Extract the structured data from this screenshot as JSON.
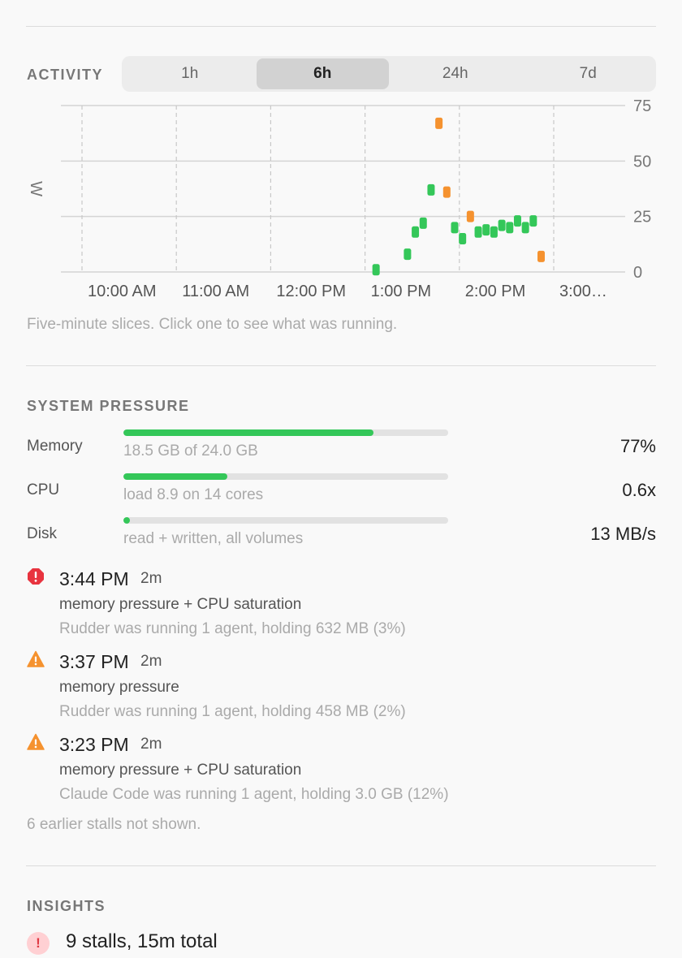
{
  "activity": {
    "title": "ACTIVITY",
    "ranges": [
      "1h",
      "6h",
      "24h",
      "7d"
    ],
    "selected_range": "6h",
    "hint": "Five-minute slices. Click one to see what was running."
  },
  "chart_data": {
    "type": "scatter",
    "ylabel": "W",
    "ylim": [
      0,
      75
    ],
    "yticks": [
      0,
      25,
      50,
      75
    ],
    "x_labels": [
      "10:00 AM",
      "11:00 AM",
      "12:00 PM",
      "1:00 PM",
      "2:00 PM",
      "3:00…"
    ],
    "x_unit": "hours since 10:00 AM on tick axis",
    "grid": true,
    "colors": {
      "normal": "#34c759",
      "stall": "#f5922f"
    },
    "points": [
      {
        "x": "13:07",
        "y": 1,
        "status": "normal"
      },
      {
        "x": "13:27",
        "y": 8,
        "status": "normal"
      },
      {
        "x": "13:32",
        "y": 18,
        "status": "normal"
      },
      {
        "x": "13:37",
        "y": 22,
        "status": "normal"
      },
      {
        "x": "13:42",
        "y": 37,
        "status": "normal"
      },
      {
        "x": "13:47",
        "y": 67,
        "status": "stall"
      },
      {
        "x": "13:52",
        "y": 36,
        "status": "stall"
      },
      {
        "x": "13:57",
        "y": 20,
        "status": "normal"
      },
      {
        "x": "14:02",
        "y": 15,
        "status": "normal"
      },
      {
        "x": "14:07",
        "y": 25,
        "status": "stall"
      },
      {
        "x": "14:12",
        "y": 18,
        "status": "normal"
      },
      {
        "x": "14:17",
        "y": 19,
        "status": "normal"
      },
      {
        "x": "14:22",
        "y": 18,
        "status": "normal"
      },
      {
        "x": "14:27",
        "y": 21,
        "status": "normal"
      },
      {
        "x": "14:32",
        "y": 20,
        "status": "normal"
      },
      {
        "x": "14:37",
        "y": 23,
        "status": "normal"
      },
      {
        "x": "14:42",
        "y": 20,
        "status": "normal"
      },
      {
        "x": "14:47",
        "y": 23,
        "status": "normal"
      },
      {
        "x": "14:52",
        "y": 7,
        "status": "stall"
      }
    ]
  },
  "system": {
    "title": "SYSTEM PRESSURE",
    "rows": [
      {
        "label": "Memory",
        "sub": "18.5 GB of 24.0 GB",
        "value": "77%",
        "fill": 0.77
      },
      {
        "label": "CPU",
        "sub": "load 8.9 on 14 cores",
        "value": "0.6x",
        "fill": 0.32
      },
      {
        "label": "Disk",
        "sub": "read + written, all volumes",
        "value": "13 MB/s",
        "fill": 0.02
      }
    ]
  },
  "stalls": {
    "items": [
      {
        "icon": "error-octagon-icon",
        "time": "3:44 PM",
        "duration": "2m",
        "desc": "memory pressure + CPU saturation",
        "detail": "Rudder was running 1 agent, holding 632 MB (3%)",
        "color": "#e8343f"
      },
      {
        "icon": "warning-triangle-icon",
        "time": "3:37 PM",
        "duration": "2m",
        "desc": "memory pressure",
        "detail": "Rudder was running 1 agent, holding 458 MB (2%)",
        "color": "#f5922f"
      },
      {
        "icon": "warning-triangle-icon",
        "time": "3:23 PM",
        "duration": "2m",
        "desc": "memory pressure + CPU saturation",
        "detail": "Claude Code was running 1 agent, holding 3.0 GB (12%)",
        "color": "#f5922f"
      }
    ],
    "more": "6 earlier stalls not shown."
  },
  "insights": {
    "title": "INSIGHTS",
    "badge": "!",
    "summary": "9 stalls, 15m total"
  }
}
